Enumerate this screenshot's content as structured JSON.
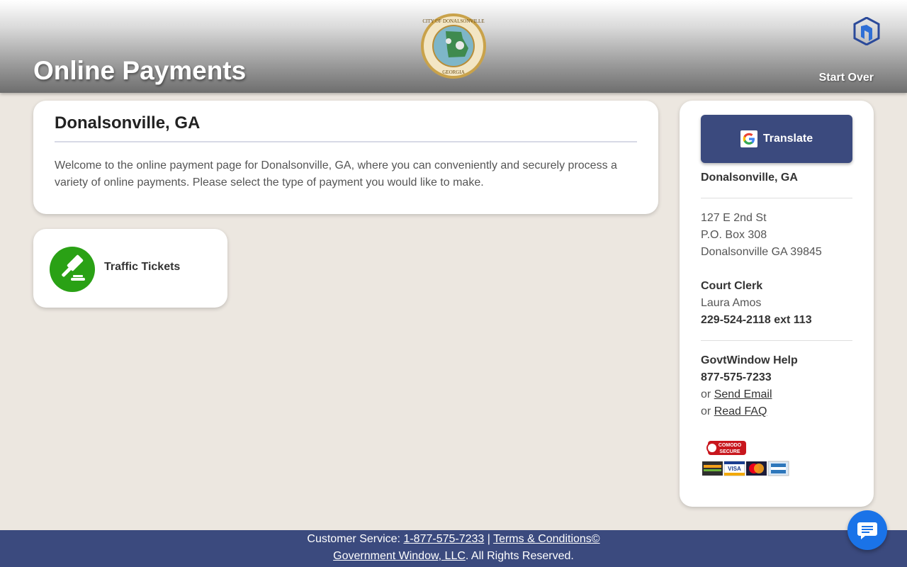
{
  "header": {
    "title": "Online Payments",
    "seal_text_top": "CITY OF DONALSONVILLE",
    "seal_text_bottom": "GEORGIA",
    "start_over": "Start Over"
  },
  "welcome": {
    "title": "Donalsonville, GA",
    "text": "Welcome to the online payment page for Donalsonville, GA, where you can conveniently and securely process a variety of online payments. Please select the type of payment you would like to make."
  },
  "payment_tiles": [
    {
      "label": "Traffic Tickets",
      "icon": "gavel-icon"
    }
  ],
  "sidebar": {
    "translate_label": "Translate",
    "city": "Donalsonville, GA",
    "address": [
      "127 E 2nd St",
      "P.O. Box 308",
      "Donalsonville GA 39845"
    ],
    "clerk_title": "Court Clerk",
    "clerk_name": "Laura Amos",
    "clerk_phone": "229-524-2118 ext 113",
    "help_title": "GovtWindow Help",
    "help_phone": "877-575-7233",
    "or": "or",
    "email_link": "Send Email",
    "faq_link": "Read FAQ",
    "secure_badge_line1": "COMODO",
    "secure_badge_line2": "SECURE"
  },
  "footer": {
    "cs_label": "Customer Service:",
    "cs_phone": "1-877-575-7233",
    "separator": "|",
    "terms": "Terms & Conditions©",
    "company": "Government Window, LLC",
    "rights": ". All Rights Reserved."
  },
  "colors": {
    "accent": "#3b4a7e",
    "tile_green": "#2aa115",
    "chat_blue": "#1a73e8",
    "page_bg": "#ece7e0"
  }
}
